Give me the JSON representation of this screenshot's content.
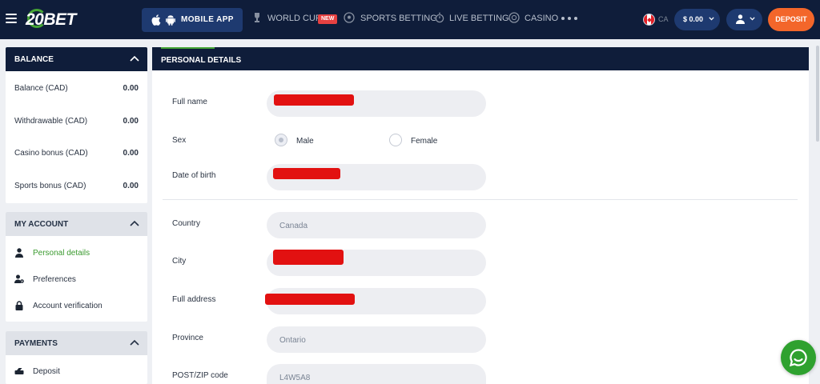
{
  "header": {
    "logo_text": "20BET",
    "mobile_app_label": "MOBILE APP",
    "nav": [
      {
        "label": "WORLD CUP",
        "icon": "trophy-icon",
        "badge": "NEW"
      },
      {
        "label": "SPORTS BETTING",
        "icon": "soccer-ball-icon"
      },
      {
        "label": "LIVE BETTING",
        "icon": "live-stopwatch-icon"
      },
      {
        "label": "CASINO",
        "icon": "casino-chip-icon"
      }
    ],
    "country_code": "CA",
    "balance": "$ 0.00",
    "deposit_label": "DEPOSIT"
  },
  "sidebar": {
    "balance": {
      "title": "BALANCE",
      "rows": [
        {
          "label": "Balance (CAD)",
          "value": "0.00"
        },
        {
          "label": "Withdrawable (CAD)",
          "value": "0.00"
        },
        {
          "label": "Casino bonus (CAD)",
          "value": "0.00"
        },
        {
          "label": "Sports bonus (CAD)",
          "value": "0.00"
        }
      ]
    },
    "account": {
      "title": "MY ACCOUNT",
      "items": [
        {
          "label": "Personal details",
          "icon": "user-icon",
          "active": true
        },
        {
          "label": "Preferences",
          "icon": "preferences-icon"
        },
        {
          "label": "Account verification",
          "icon": "lock-icon"
        }
      ]
    },
    "payments": {
      "title": "PAYMENTS",
      "items": [
        {
          "label": "Deposit",
          "icon": "deposit-icon"
        }
      ]
    }
  },
  "main": {
    "title": "PERSONAL DETAILS",
    "fields": {
      "full_name": {
        "label": "Full name",
        "value": ""
      },
      "sex": {
        "label": "Sex",
        "options": [
          "Male",
          "Female"
        ],
        "selected": "Male"
      },
      "dob": {
        "label": "Date of birth",
        "value": ""
      },
      "country": {
        "label": "Country",
        "value": "Canada"
      },
      "city": {
        "label": "City",
        "value": ""
      },
      "address": {
        "label": "Full address",
        "value": ""
      },
      "province": {
        "label": "Province",
        "value": "Ontario"
      },
      "zip": {
        "label": "POST/ZIP code",
        "value": "L4W5A8"
      }
    }
  },
  "colors": {
    "navy": "#0f1d3a",
    "nav_button": "#1e3a70",
    "deposit_orange": "#f3662a",
    "active_green": "#3a9a2e",
    "chat_green": "#2fa12f",
    "redaction_red": "#e21111"
  }
}
